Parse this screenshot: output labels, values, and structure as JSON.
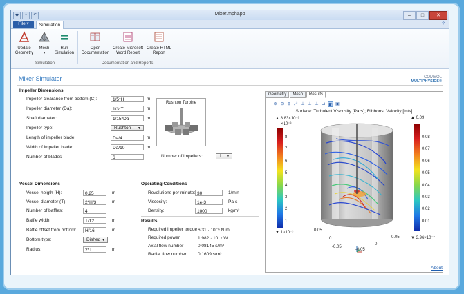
{
  "window": {
    "title": "Mixer.mphapp"
  },
  "ribbon": {
    "file_tab": "File ▾",
    "sim_tab": "Simulation",
    "help": "?",
    "buttons": {
      "update_geometry": "Update Geometry",
      "mesh": "Mesh",
      "mesh_arrow": "▾",
      "run_simulation": "Run Simulation",
      "open_documentation": "Open Documentation",
      "create_word_report": "Create Microsoft Word Report",
      "create_html_report": "Create HTML Report"
    },
    "groups": {
      "simulation": "Simulation",
      "doc_reports": "Documentation and Reports"
    }
  },
  "app": {
    "title": "Mixer Simulator",
    "logo_top": "COMSOL",
    "logo_bottom": "MULTIPHYSICS®",
    "about": "About"
  },
  "impeller": {
    "header": "Impeller Dimensions",
    "clearance_label": "Impeller clearance from bottom (C):",
    "clearance_value": "1/5*H",
    "clearance_unit": "m",
    "diameter_label": "Impeller diameter (Da):",
    "diameter_value": "1/3*T",
    "diameter_unit": "m",
    "shaft_label": "Shaft diameter:",
    "shaft_value": "1/15*Da",
    "shaft_unit": "m",
    "type_label": "Impeller type:",
    "type_value": "Rushton",
    "blade_length_label": "Length of impeller blade:",
    "blade_length_value": "Da/4",
    "blade_length_unit": "m",
    "blade_width_label": "Width of impeller blade:",
    "blade_width_value": "Da/10",
    "blade_width_unit": "m",
    "blades_label": "Number of blades",
    "blades_value": "6",
    "turbine_title": "Rushton Turbine",
    "num_impellers_label": "Number of impellers:",
    "num_impellers_value": "1"
  },
  "vessel": {
    "header": "Vessel Dimensions",
    "height_label": "Vessel heigth (H):",
    "height_value": "0.25",
    "height_unit": "m",
    "diameter_label": "Vessel diameter (T):",
    "diameter_value": "2*H/3",
    "diameter_unit": "m",
    "baffles_label": "Number of baffles:",
    "baffles_value": "4",
    "baffle_width_label": "Baffle width:",
    "baffle_width_value": "T/12",
    "baffle_width_unit": "m",
    "baffle_offset_label": "Baffle offset from bottom:",
    "baffle_offset_value": "H/16",
    "baffle_offset_unit": "m",
    "bottom_label": "Bottom type:",
    "bottom_value": "Dished",
    "radius_label": "Radius:",
    "radius_value": "2*T",
    "radius_unit": "m"
  },
  "operating": {
    "header": "Operating Conditions",
    "rpm_label": "Revolutions per minute:",
    "rpm_value": "30",
    "rpm_unit": "1/min",
    "viscosity_label": "Viscosity:",
    "viscosity_value": "1e-3",
    "viscosity_unit": "Pa·s",
    "density_label": "Density:",
    "density_value": "1000",
    "density_unit": "kg/m³"
  },
  "results": {
    "header": "Results",
    "torque_label": "Required impeller torque",
    "torque_value": "6.31 · 10⁻⁶ N·m",
    "power_label": "Required power",
    "power_value": "1.982 · 10⁻⁵ W",
    "axial_label": "Axial flow number",
    "axial_value": "0.08145 s/m³",
    "radial_label": "Radial flow number",
    "radial_value": "0.1609 s/m³"
  },
  "graphics": {
    "tabs": [
      "Geometry",
      "Mesh",
      "Results"
    ],
    "plot_title": "Surface: Turbulent Viscosity [Pa*s]; Ribbons: Velocity [m/s]",
    "left_bar": {
      "max": "▲ 8.83×10⁻³",
      "exp": "×10⁻³",
      "ticks": [
        "8",
        "7",
        "6",
        "5",
        "4",
        "3",
        "2",
        "1"
      ],
      "min": "▼ 1×10⁻³"
    },
    "right_bar": {
      "max": "▲ 0.09",
      "ticks": [
        "0.08",
        "0.07",
        "0.06",
        "0.05",
        "0.04",
        "0.03",
        "0.02",
        "0.01"
      ],
      "min": "▼ 3.96×10⁻⁷"
    },
    "axis_labels": [
      "0.05",
      "0",
      "-0.05",
      "-0.05",
      "0",
      "0.05"
    ]
  }
}
